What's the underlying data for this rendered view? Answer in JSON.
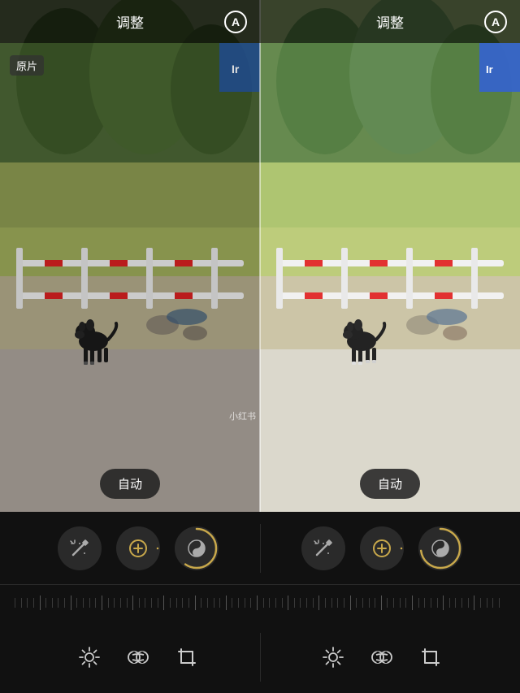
{
  "header": {
    "left": {
      "title": "调整",
      "icon_label": "A"
    },
    "right": {
      "title": "调整",
      "icon_label": "A"
    }
  },
  "photo": {
    "original_label": "原片",
    "watermark": "小红书",
    "auto_label": "自动"
  },
  "toolbar": {
    "icon_groups": [
      {
        "icons": [
          {
            "name": "wand",
            "label": "智能调整",
            "has_ring": false
          },
          {
            "name": "plus-circle",
            "label": "添加",
            "has_ring": true,
            "ring_pct": 0
          },
          {
            "name": "yin-yang",
            "label": "对比度",
            "has_ring": true,
            "ring_pct": 60
          }
        ]
      },
      {
        "icons": [
          {
            "name": "wand",
            "label": "智能调整",
            "has_ring": false
          },
          {
            "name": "plus-circle",
            "label": "添加",
            "has_ring": true,
            "ring_pct": 0
          },
          {
            "name": "yin-yang",
            "label": "对比度",
            "has_ring": true,
            "ring_pct": 75
          }
        ]
      }
    ],
    "bottom_icons": [
      {
        "name": "sun",
        "label": "亮度"
      },
      {
        "name": "link",
        "label": "链接"
      },
      {
        "name": "crop",
        "label": "裁剪"
      }
    ],
    "colors": {
      "gold": "#c8a84b",
      "dark_bg": "#111111",
      "icon_bg": "#2a2a2a"
    }
  }
}
